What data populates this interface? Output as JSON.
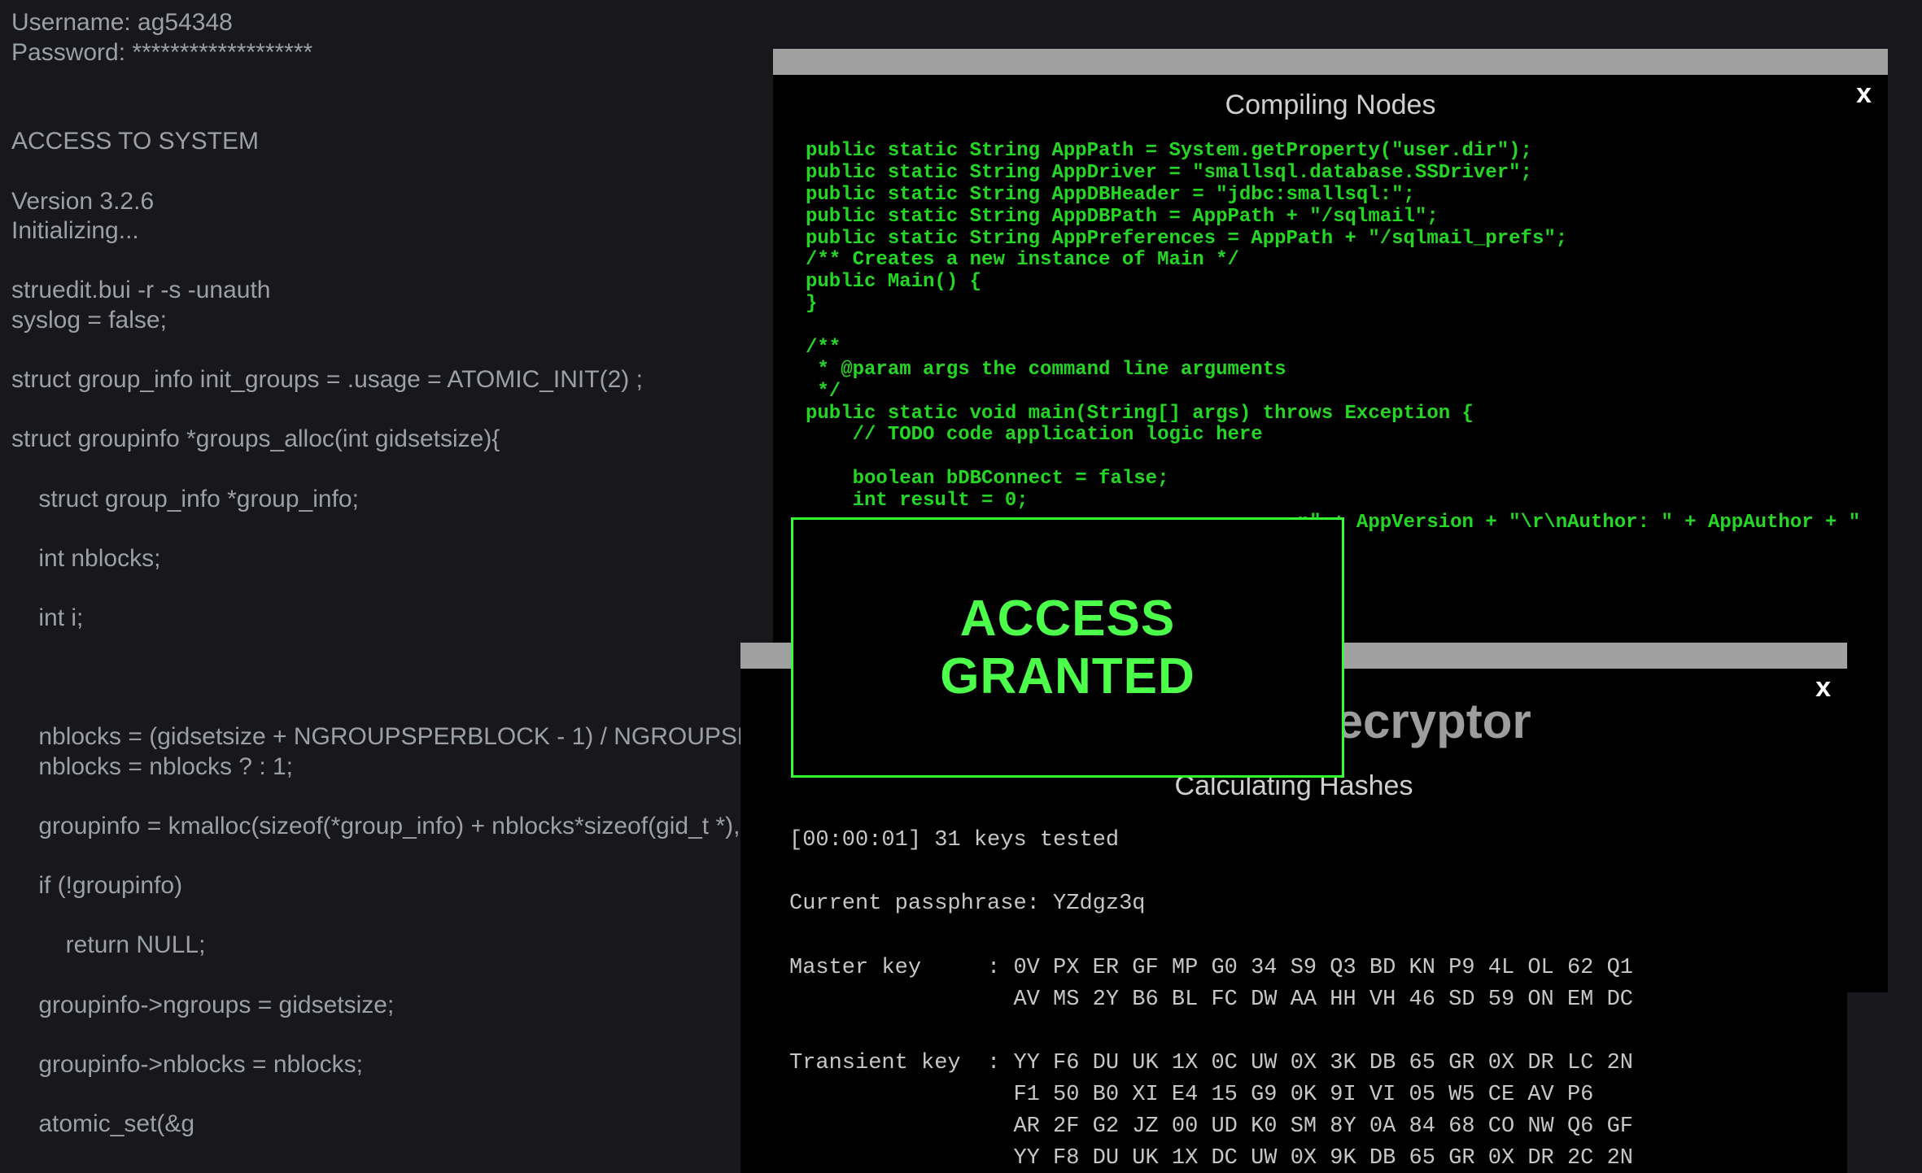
{
  "terminal": {
    "text": "Username: ag54348\nPassword: *******************\n\n\nACCESS TO SYSTEM\n\nVersion 3.2.6\nInitializing...\n\nstruedit.bui -r -s -unauth\nsyslog = false;\n\nstruct group_info init_groups = .usage = ATOMIC_INIT(2) ;\n\nstruct groupinfo *groups_alloc(int gidsetsize){\n\n    struct group_info *group_info;\n\n    int nblocks;\n\n    int i;\n\n\n\n    nblocks = (gidsetsize + NGROUPSPERBLOCK - 1) / NGROUPSPERBLOCK;\n    nblocks = nblocks ? : 1;\n\n    groupinfo = kmalloc(sizeof(*group_info) + nblocks*sizeof(gid_t *), GFP_USER);\n\n    if (!groupinfo)\n\n        return NULL;\n\n    groupinfo->ngroups = gidsetsize;\n\n    groupinfo->nblocks = nblocks;\n\n    atomic_set(&g"
  },
  "compile": {
    "title": "Compiling Nodes",
    "close": "x",
    "code": "public static String AppPath = System.getProperty(\"user.dir\");\npublic static String AppDriver = \"smallsql.database.SSDriver\";\npublic static String AppDBHeader = \"jdbc:smallsql:\";\npublic static String AppDBPath = AppPath + \"/sqlmail\";\npublic static String AppPreferences = AppPath + \"/sqlmail_prefs\";\n/** Creates a new instance of Main */\npublic Main() {\n}\n\n/**\n * @param args the command line arguments\n */\npublic static void main(String[] args) throws Exception {\n    // TODO code application logic here\n\n    boolean bDBConnect = false;\n    int result = 0;\n                                          n\" + AppVersion + \"\\r\\nAuthor: \" + AppAuthor + \""
  },
  "decrypt": {
    "bigtitle": "Password Decryptor",
    "subtitle": "Calculating Hashes",
    "close": "x",
    "body": "[00:00:01] 31 keys tested\n\nCurrent passphrase: YZdgz3q\n\nMaster key     : 0V PX ER GF MP G0 34 S9 Q3 BD KN P9 4L OL 62 Q1\n                 AV MS 2Y B6 BL FC DW AA HH VH 46 SD 59 ON EM DC\n\nTransient key  : YY F6 DU UK 1X 0C UW 0X 3K DB 65 GR 0X DR LC 2N\n                 F1 50 B0 XI E4 15 G9 0K 9I VI 05 W5 CE AV P6\n                 AR 2F G2 JZ 00 UD K0 SM 8Y 0A 84 68 CO NW Q6 GF\n                 YY F8 DU UK 1X DC UW 0X 9K DB 65 GR 0X DR 2C 2N"
  },
  "access": {
    "line1": "ACCESS",
    "line2": "GRANTED"
  }
}
